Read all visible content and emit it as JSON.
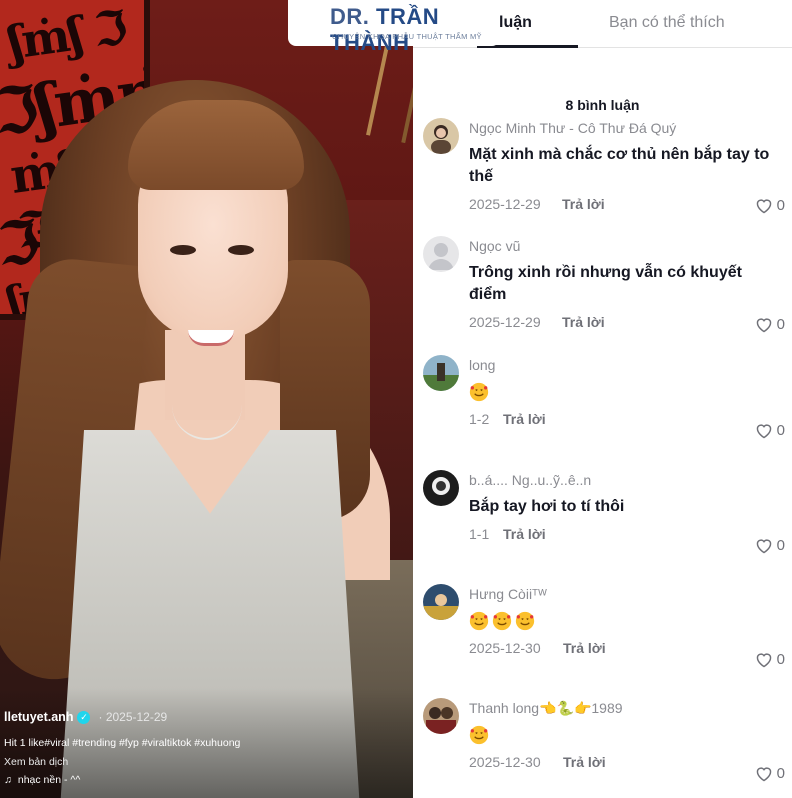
{
  "watermark": {
    "title_prefix": "DR. ",
    "title_name": "TRẦN THÀNH",
    "subtitle": "CHUYÊN KHOA PHẪU THUẬT THẨM MỸ"
  },
  "video": {
    "author": "lletuyet.anh",
    "date": "2025-12-29",
    "description": "Hit 1 like#viral #trending #fyp #viraltiktok #xuhuong",
    "translate_label": "Xem bản dịch",
    "music_icon": "♫",
    "music_label": "nhạc nền - ^^"
  },
  "tabs": {
    "active": "luận",
    "other": "Bạn có thể thích"
  },
  "comments_count": "8 bình luận",
  "comments": [
    {
      "name": "Ngọc Minh Thư - Cô Thư Đá Quý",
      "text": "Mặt xinh mà chắc cơ thủ nên bắp tay to thế",
      "date": "2025-12-29",
      "reply": "Trả lời",
      "likes": "0",
      "emoji_count": 0
    },
    {
      "name": "Ngọc vũ",
      "text": "Trông xinh rồi nhưng vẫn có khuyết điểm",
      "date": "2025-12-29",
      "reply": "Trả lời",
      "likes": "0",
      "emoji_count": 0
    },
    {
      "name": "long",
      "text": "",
      "date": "1-2",
      "reply": "Trả lời",
      "likes": "0",
      "emoji_count": 1
    },
    {
      "name": "b..á.... Ng..u..ỹ..ê..n",
      "text": "Bắp tay hơi to tí thôi",
      "date": "1-1",
      "reply": "Trả lời",
      "likes": "0",
      "emoji_count": 0
    },
    {
      "name": "Hưng Còiiᵀᵂ",
      "text": "",
      "date": "2025-12-30",
      "reply": "Trả lời",
      "likes": "0",
      "emoji_count": 3
    },
    {
      "name": "Thanh long",
      "name_suffix": "1989",
      "text": "",
      "date": "2025-12-30",
      "reply": "Trả lời",
      "likes": "0",
      "emoji_count": 1
    }
  ],
  "icons": {
    "verified": "verified-badge-icon",
    "heart": "heart-outline-icon",
    "music": "music-note-icon",
    "emoji": "smiling-face-with-hearts-icon"
  },
  "colors": {
    "primary_text": "#161823",
    "secondary_text": "#8a8b91",
    "watermark_blue": "#3f5b8c",
    "verified": "#20d5ec"
  }
}
